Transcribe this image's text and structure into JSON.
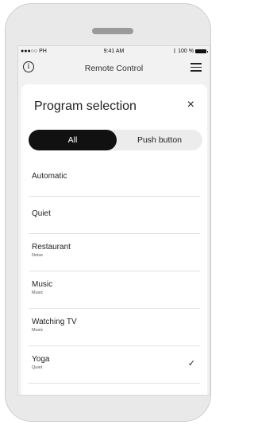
{
  "status": {
    "carrier": "●●●○○ PH",
    "time": "9:41 AM",
    "battery": "100 %"
  },
  "appbar": {
    "title": "Remote Control"
  },
  "sheet": {
    "title": "Program selection",
    "close": "×"
  },
  "segments": {
    "all": "All",
    "push": "Push button",
    "selected": "All"
  },
  "programs": [
    {
      "name": "Automatic",
      "sub": ""
    },
    {
      "name": "Quiet",
      "sub": ""
    },
    {
      "name": "Restaurant",
      "sub": "Noise"
    },
    {
      "name": "Music",
      "sub": "Music"
    },
    {
      "name": "Watching TV",
      "sub": "Music"
    },
    {
      "name": "Yoga",
      "sub": "Quiet",
      "selected": true
    }
  ],
  "icons": {
    "info": "info-icon",
    "menu": "hamburger-menu-icon",
    "check": "checkmark-icon",
    "close": "close-icon"
  }
}
